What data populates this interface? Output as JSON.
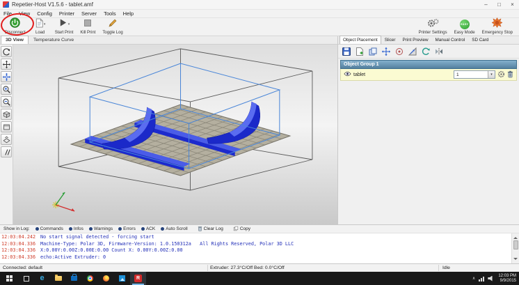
{
  "colors": {
    "annotation_red": "#e11d1d",
    "model_blue": "#1b29c9",
    "easy_green": "#3fae49",
    "group_header_blue": "#54809f",
    "log_time_red": "#cf3b28",
    "log_text_blue": "#2330b8"
  },
  "glyphs": {
    "dropdown": "▾",
    "tray_chevron": "∧"
  },
  "window": {
    "title": "Repetier-Host V1.5.6 - tablet.amf",
    "minimize": "–",
    "maximize": "□",
    "close": "×"
  },
  "menu": {
    "items": [
      "File",
      "View",
      "Config",
      "Printer",
      "Server",
      "Tools",
      "Help"
    ]
  },
  "toolbar": {
    "left": [
      {
        "label": "Disconnect",
        "icon": "power-icon"
      },
      {
        "label": "Load",
        "icon": "document-icon",
        "has_dropdown": true
      },
      {
        "label": "Start Print",
        "icon": "play-icon",
        "has_dropdown": true
      },
      {
        "label": "Kill Print",
        "icon": "stop-icon"
      },
      {
        "label": "Toggle Log",
        "icon": "pencil-icon"
      }
    ],
    "right": [
      {
        "label": "Printer Settings",
        "icon": "gears-icon"
      },
      {
        "label": "Easy Mode",
        "icon": "easy-ball-icon",
        "badge": "EASY"
      },
      {
        "label": "Emergency Stop",
        "icon": "emergency-stop-icon"
      }
    ]
  },
  "view_tabs": {
    "active": "3D View",
    "items": [
      {
        "label": "3D View"
      },
      {
        "label": "Temperature Curve"
      }
    ]
  },
  "view_toolbar_icons": [
    "rotate-view-icon",
    "move-view-icon",
    "move-object-icon",
    "zoom-in-icon",
    "zoom-out-icon",
    "iso-view-icon",
    "front-view-icon",
    "top-view-icon",
    "parallel-projection-icon"
  ],
  "right_panel": {
    "tabs": [
      {
        "label": "Object Placement"
      },
      {
        "label": "Slicer"
      },
      {
        "label": "Print Preview"
      },
      {
        "label": "Manual Control"
      },
      {
        "label": "SD Card"
      }
    ],
    "active_tab": "Object Placement",
    "toolbar_icons": [
      "save-stl-icon",
      "add-object-icon",
      "copy-object-icon",
      "autoposition-icon",
      "center-object-icon",
      "scale-object-icon",
      "rotate-object-icon",
      "mirror-object-icon"
    ],
    "group_header": "Object Group 1",
    "object": {
      "name": "tablet",
      "copies": "1"
    }
  },
  "log": {
    "label": "Show in Log:",
    "filters": [
      {
        "label": "Commands",
        "dot_color": "#24427c"
      },
      {
        "label": "Infos",
        "dot_color": "#24427c"
      },
      {
        "label": "Warnings",
        "dot_color": "#24427c"
      },
      {
        "label": "Errors",
        "dot_color": "#24427c"
      },
      {
        "label": "ACK",
        "dot_color": "#24427c"
      },
      {
        "label": "Auto Scroll",
        "dot_color": "#24427c"
      }
    ],
    "actions": [
      {
        "label": "Clear Log",
        "icon": "trash-icon"
      },
      {
        "label": "Copy",
        "icon": "copy-icon"
      }
    ],
    "entries": [
      {
        "time": "12:03:04.242",
        "text": "No start signal detected - forcing start"
      },
      {
        "time": "12:03:04.336",
        "text": "Machine-Type: Polar 3D, Firmware-Version: 1.0.150312a   All Rights Reserved, Polar 3D LLC"
      },
      {
        "time": "12:03:04.336",
        "text": "X:0.00Y:0.00Z:0.00E:0.00 Count X: 0.00Y:0.00Z:0.00"
      },
      {
        "time": "12:03:04.336",
        "text": "echo:Active Extruder: 0"
      }
    ]
  },
  "status": {
    "connection": "Connected: default",
    "temps": "Extruder: 27.3°C/Off Bed: 0.0°C/Off",
    "state": "Idle"
  },
  "taskbar": {
    "icons": [
      {
        "name": "task-view"
      },
      {
        "name": "edge",
        "glyph": "e"
      },
      {
        "name": "file-explorer"
      },
      {
        "name": "store"
      },
      {
        "name": "chrome"
      },
      {
        "name": "firefox"
      },
      {
        "name": "photos"
      },
      {
        "name": "repetier-host",
        "glyph": "R"
      }
    ],
    "tray_icons": [
      "chevron-up-icon",
      "network-icon",
      "volume-icon"
    ],
    "time": "12:03 PM",
    "date": "9/9/2015"
  }
}
